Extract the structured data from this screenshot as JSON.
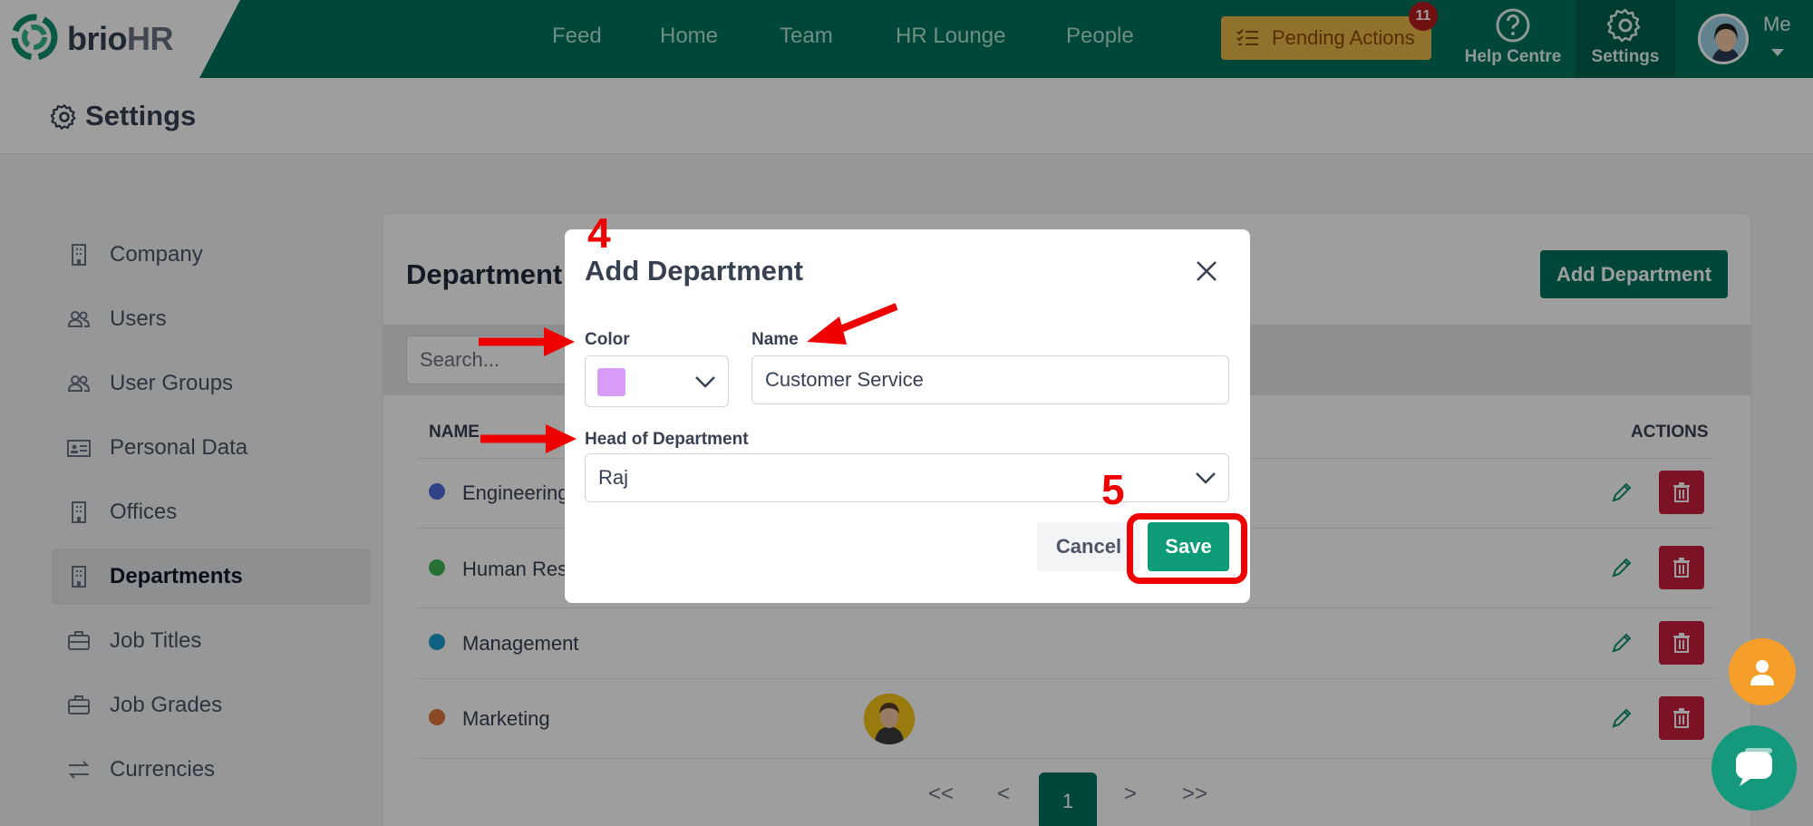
{
  "brand": {
    "logo_main": "brio",
    "logo_suffix": "HR"
  },
  "nav": {
    "links": [
      "Feed",
      "Home",
      "Team",
      "HR Lounge",
      "People"
    ],
    "pending_label": "Pending Actions",
    "pending_count": "11",
    "help_label": "Help Centre",
    "settings_label": "Settings",
    "me_label": "Me"
  },
  "page": {
    "title": "Settings"
  },
  "sidebar": {
    "items": [
      {
        "label": "Company",
        "icon": "building-icon"
      },
      {
        "label": "Users",
        "icon": "users-icon"
      },
      {
        "label": "User Groups",
        "icon": "users-icon"
      },
      {
        "label": "Personal Data",
        "icon": "id-card-icon"
      },
      {
        "label": "Offices",
        "icon": "building-icon"
      },
      {
        "label": "Departments",
        "icon": "building-icon"
      },
      {
        "label": "Job Titles",
        "icon": "briefcase-icon"
      },
      {
        "label": "Job Grades",
        "icon": "briefcase-icon"
      },
      {
        "label": "Currencies",
        "icon": "exchange-icon"
      }
    ],
    "active": "Departments"
  },
  "departments": {
    "title": "Department",
    "add_button": "Add Department",
    "search_placeholder": "Search...",
    "columns": {
      "name": "NAME",
      "actions": "ACTIONS"
    },
    "rows": [
      {
        "name": "Engineering",
        "color": "#4f6bd8"
      },
      {
        "name": "Human Res",
        "color": "#3fb65a"
      },
      {
        "name": "Management",
        "color": "#1b9bd0"
      },
      {
        "name": "Marketing",
        "color": "#e0743a"
      }
    ],
    "pagination": {
      "first": "<<",
      "prev": "<",
      "current": "1",
      "next": ">",
      "last": ">>"
    }
  },
  "modal": {
    "title": "Add Department",
    "color_label": "Color",
    "color_value": "#d79df7",
    "name_label": "Name",
    "name_value": "Customer Service",
    "head_label": "Head of Department",
    "head_value": "Raj",
    "cancel_label": "Cancel",
    "save_label": "Save"
  },
  "annotations": {
    "step_4": "4",
    "step_5": "5"
  },
  "colors": {
    "brand_green": "#00715c",
    "save_green": "#0d9b78",
    "annotation_red": "#ef0000",
    "pending_yellow": "#e9b84a"
  }
}
